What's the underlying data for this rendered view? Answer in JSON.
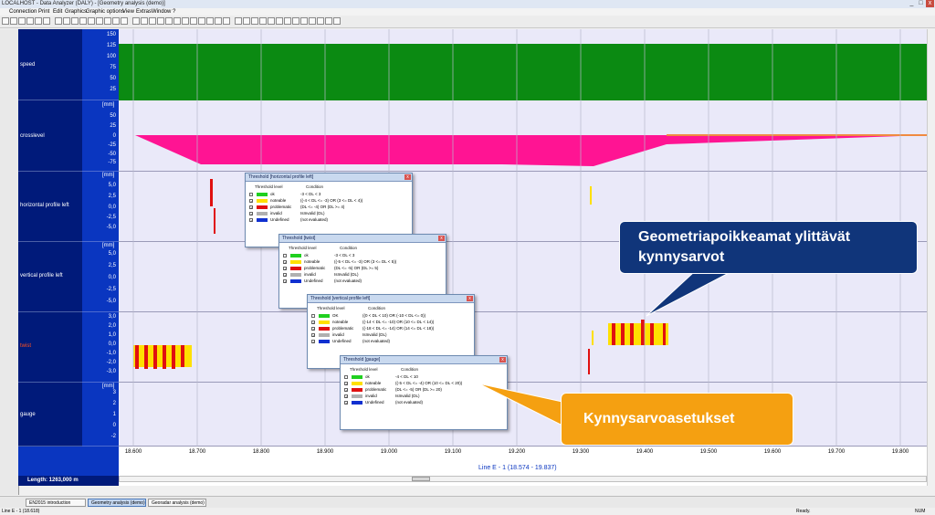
{
  "window": {
    "title": "LOCALHOST - Data Analyzer (DALY) - [Geometry analysis (demo)]",
    "controls": [
      "_",
      "□",
      "x"
    ]
  },
  "menu": [
    "Connection",
    "Print",
    "Edit",
    "Graphics",
    "Graphic options",
    "View",
    "Extras",
    "Window",
    "?"
  ],
  "tracks": [
    {
      "label": "speed",
      "unit": "",
      "ticks": [
        "150",
        "125",
        "100",
        "75",
        "50",
        "25"
      ]
    },
    {
      "label": "crosslevel",
      "unit": "[mm]",
      "ticks": [
        "50",
        "25",
        "0",
        "-25",
        "-50",
        "-75",
        "-100",
        "-125"
      ]
    },
    {
      "label": "horizontal profile left",
      "unit": "[mm]",
      "ticks": [
        "7,5",
        "5,0",
        "2,5",
        "0,0",
        "-2,5",
        "-5,0",
        "-7,5"
      ]
    },
    {
      "label": "vertical profile left",
      "unit": "[mm]",
      "ticks": [
        "5,0",
        "2,5",
        "0,0",
        "-2,5",
        "-5,0"
      ]
    },
    {
      "label": "twist",
      "unit": "",
      "ticks": [
        "3,0",
        "2,0",
        "1,0",
        "0,0",
        "-1,0",
        "-2,0",
        "-3,0",
        "-4,0"
      ]
    },
    {
      "label": "gauge",
      "unit": "[mm]",
      "ticks": [
        "3",
        "2",
        "1",
        "0",
        "-1",
        "-2",
        "-3"
      ]
    }
  ],
  "x_axis": {
    "ticks": [
      "18.600",
      "18.700",
      "18.800",
      "18.900",
      "19.000",
      "19.100",
      "19.200",
      "19.300",
      "19.400",
      "19.500",
      "19.600",
      "19.700",
      "19.800"
    ]
  },
  "footer": {
    "length_label": "Length: 1263,000 m",
    "line_label": "Line E - 1 (18.574 - 19.837)"
  },
  "taskbar": [
    "EN2015 introduction",
    "Geometry analysis (demo)",
    "Georadar analysis (demo)"
  ],
  "status": {
    "left": "Line E - 1 (18.618)",
    "ready": "Ready.",
    "num": "NUM"
  },
  "dialogs": [
    {
      "title": "Threshold [horizontal profile left]",
      "col1": "Threshold level",
      "col2": "Condition",
      "rows": [
        {
          "level": "ok",
          "cond": "-3 < DL < 3",
          "checked": false,
          "color": "#20d020"
        },
        {
          "level": "noteable",
          "cond": "((-4 < DL <= -3) OR (3 <= DL < 4))",
          "checked": true,
          "color": "#ffe000"
        },
        {
          "level": "problematic",
          "cond": "(DL <= -4) OR (DL >= 4)",
          "checked": true,
          "color": "#e01010"
        },
        {
          "level": "invalid",
          "cond": "IsInvalid (DL)",
          "checked": true,
          "color": "#b0b0b0"
        },
        {
          "level": "Undefined",
          "cond": "(not evaluated)",
          "checked": true,
          "color": "#1030d0"
        }
      ]
    },
    {
      "title": "Threshold [twist]",
      "col1": "Threshold level",
      "col2": "Condition",
      "rows": [
        {
          "level": "ok",
          "cond": "-3 < DL < 3",
          "checked": false,
          "color": "#20d020"
        },
        {
          "level": "noteable",
          "cond": "((-5 < DL <= -3) OR (3 <= DL < 5))",
          "checked": true,
          "color": "#ffe000"
        },
        {
          "level": "problematic",
          "cond": "(DL <= -5) OR (DL >= 5)",
          "checked": true,
          "color": "#e01010"
        },
        {
          "level": "invalid",
          "cond": "IsInvalid (DL)",
          "checked": true,
          "color": "#b0b0b0"
        },
        {
          "level": "Undefined",
          "cond": "(not evaluated)",
          "checked": true,
          "color": "#1030d0"
        }
      ]
    },
    {
      "title": "Threshold [vertical profile left]",
      "col1": "Threshold level",
      "col2": "Condition",
      "rows": [
        {
          "level": "OK",
          "cond": "((0 < DL < 10) OR (-10 < DL <= 0))",
          "checked": false,
          "color": "#20d020"
        },
        {
          "level": "noteable",
          "cond": "((-14 < DL <= -10) OR (10 <= DL < 14))",
          "checked": true,
          "color": "#ffe000"
        },
        {
          "level": "problematic",
          "cond": "((-18 < DL <= -14) OR (14 <= DL < 18))",
          "checked": true,
          "color": "#e01010"
        },
        {
          "level": "invalid",
          "cond": "IsInvalid (DL)",
          "checked": true,
          "color": "#b0b0b0"
        },
        {
          "level": "Undefined",
          "cond": "(not evaluated)",
          "checked": true,
          "color": "#1030d0"
        }
      ]
    },
    {
      "title": "Threshold [gauge]",
      "col1": "Threshold level",
      "col2": "Condition",
      "rows": [
        {
          "level": "ok",
          "cond": "-4 < DL < 10",
          "checked": false,
          "color": "#20d020"
        },
        {
          "level": "noteable",
          "cond": "((-5 < DL <= -4) OR (10 <= DL < 20))",
          "checked": true,
          "color": "#ffe000"
        },
        {
          "level": "problematic",
          "cond": "(DL <= -5) OR (DL >= 20)",
          "checked": true,
          "color": "#e01010"
        },
        {
          "level": "invalid",
          "cond": "IsInvalid (DL)",
          "checked": true,
          "color": "#b0b0b0"
        },
        {
          "level": "Undefined",
          "cond": "(not evaluated)",
          "checked": true,
          "color": "#1030d0"
        }
      ]
    }
  ],
  "callouts": {
    "deviations": "Geometriapoikkeamat ylittävät kynnysarvot",
    "settings": "Kynnysarvoasetukset"
  },
  "colors": {
    "speed": "#0b8a12",
    "crosslevel": "#ff1493",
    "crosslevel_tail": "#f08a40",
    "problematic": "#e01010",
    "noteable": "#ffe000",
    "callout_blue": "#10357a",
    "callout_orange": "#f5a011",
    "label_panel": "#001a7a"
  }
}
